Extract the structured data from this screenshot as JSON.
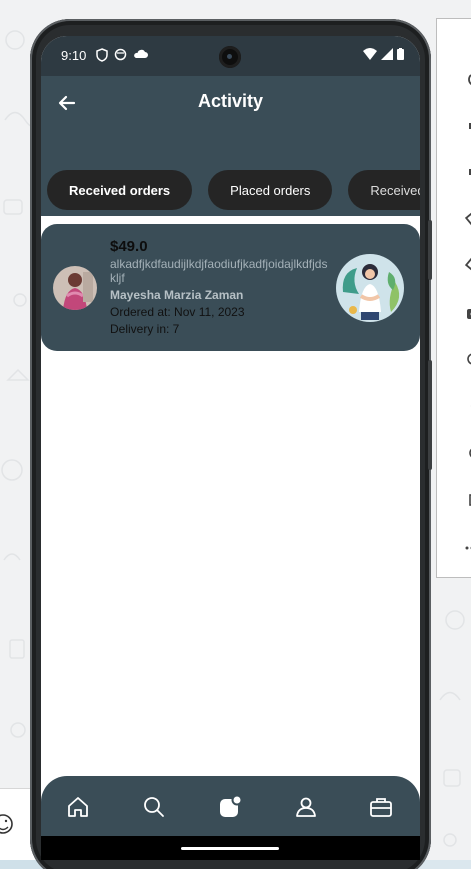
{
  "status_bar": {
    "time": "9:10"
  },
  "app_bar": {
    "title": "Activity"
  },
  "tabs": [
    {
      "label": "Received orders",
      "active": true
    },
    {
      "label": "Placed orders",
      "active": false
    },
    {
      "label": "Received C",
      "active": false
    }
  ],
  "orders": [
    {
      "price": "$49.0",
      "description": "alkadfjkdfaudijlkdjfaodiufjkadfjoidajlkdfjdskljf",
      "buyer_name": "Mayesha Marzia Zaman",
      "ordered_at": "Ordered at: Nov 11, 2023",
      "delivery": "Delivery in: 7"
    }
  ],
  "bottom_nav": [
    "home-icon",
    "search-icon",
    "activity-icon",
    "profile-icon",
    "briefcase-icon"
  ],
  "emulator_controls": [
    "power-icon",
    "volume-up-icon",
    "volume-down-icon",
    "rotate-left-icon",
    "rotate-right-icon",
    "camera-icon",
    "zoom-icon",
    "back-icon",
    "home-icon",
    "overview-icon",
    "more-icon"
  ],
  "colors": {
    "primary": "#3a4d57",
    "status_bar": "#2e3a42",
    "tab_background": "#252525",
    "page_background": "#ffffff"
  }
}
